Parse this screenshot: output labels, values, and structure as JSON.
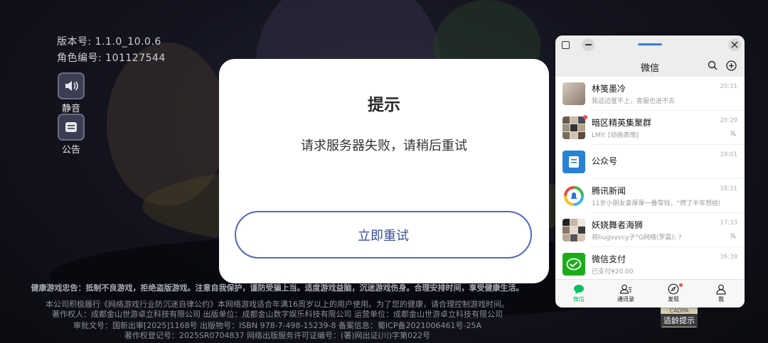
{
  "game": {
    "version_label": "版本号: 1.1.0_10.0.6",
    "role_id_label": "角色编号: 101127544",
    "mute_label": "静音",
    "notice_label": "公告",
    "health_warning": "健康游戏忠告：抵制不良游戏，拒绝盗版游戏。注意自我保护，谨防受骗上当。适度游戏益脑，沉迷游戏伤身。合理安排时间，享受健康生活。",
    "footer_line1": "本公司积极履行《网络游戏行业防沉迷自律公约》本网络游戏适合年满16周岁以上的用户使用。为了您的健康，请合理控制游戏时间。",
    "footer_line2": "著作权人：成都金山世游卓立科技有限公司 出版单位：成都金山数字娱乐科技有限公司 运营单位：成都金山世游卓立科技有限公司",
    "footer_line3": "审批文号：国新出审[2025]1168号 出版物号：ISBN 978-7-498-15239-8 备案信息：蜀ICP备2021006461号-25A",
    "footer_line4": "著作权登记号：2025SR0704837 网络出版服务许可证编号：(署)网出证(川)字第022号",
    "cadpa_label": "CADPA",
    "age_hint_label": "适龄提示"
  },
  "dialog": {
    "title": "提示",
    "message": "请求服务器失败，请稍后重试",
    "retry_button": "立即重试"
  },
  "wechat": {
    "title": "微信",
    "chats": [
      {
        "name": "林笺墨冷",
        "preview": "我这边登不上，客服也进不去",
        "time": "20:31",
        "muted": false
      },
      {
        "name": "暗区精英集聚群",
        "preview": "LMY: [动画表情]",
        "time": "20:29",
        "muted": true
      },
      {
        "name": "公众号",
        "preview": "",
        "time": "19:01",
        "muted": false
      },
      {
        "name": "腾讯新闻",
        "preview": "11岁小朋友拿厚厚一叠零钱，“攒了半年想给妈妈买…",
        "time": "18:31",
        "muted": false
      },
      {
        "name": "妖娆舞者海狮",
        "preview": "将hugvvvcy子°G网络(罗晨): ?",
        "time": "17:33",
        "muted": true
      },
      {
        "name": "微信支付",
        "preview": "已支付¥20.00",
        "time": "16:39",
        "muted": false
      }
    ],
    "tabs": [
      {
        "label": "微信"
      },
      {
        "label": "通讯录"
      },
      {
        "label": "发现"
      },
      {
        "label": "我"
      }
    ],
    "colors": {
      "accent": "#07c160",
      "dialog_button": "#5267c4"
    }
  }
}
